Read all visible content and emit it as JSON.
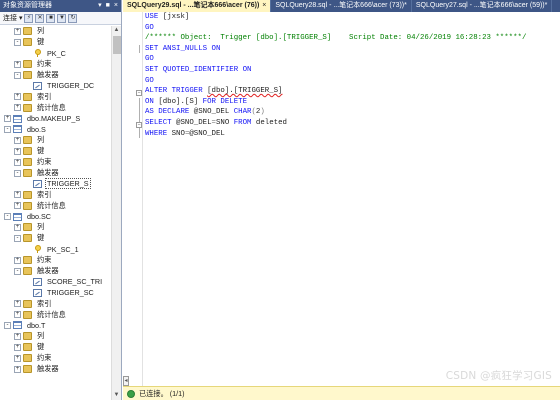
{
  "object_explorer": {
    "title": "对象资源管理器",
    "pin_icons": [
      "▾",
      "📌",
      "×"
    ],
    "toolbar": {
      "connect_label": "连接 ▾"
    },
    "tree": [
      {
        "indent": 1,
        "expander": "+",
        "icon": "folder",
        "label": "列"
      },
      {
        "indent": 1,
        "expander": "-",
        "icon": "folder",
        "label": "键"
      },
      {
        "indent": 2,
        "expander": "",
        "icon": "key",
        "label": "PK_C"
      },
      {
        "indent": 1,
        "expander": "+",
        "icon": "folder",
        "label": "约束"
      },
      {
        "indent": 1,
        "expander": "-",
        "icon": "folder",
        "label": "触发器"
      },
      {
        "indent": 2,
        "expander": "",
        "icon": "trig",
        "label": "TRIGGER_DC"
      },
      {
        "indent": 1,
        "expander": "+",
        "icon": "folder",
        "label": "索引"
      },
      {
        "indent": 1,
        "expander": "+",
        "icon": "folder",
        "label": "统计信息"
      },
      {
        "indent": 0,
        "expander": "+",
        "icon": "table",
        "label": "dbo.MAKEUP_S"
      },
      {
        "indent": 0,
        "expander": "-",
        "icon": "table",
        "label": "dbo.S"
      },
      {
        "indent": 1,
        "expander": "+",
        "icon": "folder",
        "label": "列"
      },
      {
        "indent": 1,
        "expander": "+",
        "icon": "folder",
        "label": "键"
      },
      {
        "indent": 1,
        "expander": "+",
        "icon": "folder",
        "label": "约束"
      },
      {
        "indent": 1,
        "expander": "-",
        "icon": "folder",
        "label": "触发器"
      },
      {
        "indent": 2,
        "expander": "",
        "icon": "trig",
        "label": "TRIGGER_S",
        "selected": true
      },
      {
        "indent": 1,
        "expander": "+",
        "icon": "folder",
        "label": "索引"
      },
      {
        "indent": 1,
        "expander": "+",
        "icon": "folder",
        "label": "统计信息"
      },
      {
        "indent": 0,
        "expander": "-",
        "icon": "table",
        "label": "dbo.SC"
      },
      {
        "indent": 1,
        "expander": "+",
        "icon": "folder",
        "label": "列"
      },
      {
        "indent": 1,
        "expander": "-",
        "icon": "folder",
        "label": "键"
      },
      {
        "indent": 2,
        "expander": "",
        "icon": "key",
        "label": "PK_SC_1"
      },
      {
        "indent": 1,
        "expander": "+",
        "icon": "folder",
        "label": "约束"
      },
      {
        "indent": 1,
        "expander": "-",
        "icon": "folder",
        "label": "触发器"
      },
      {
        "indent": 2,
        "expander": "",
        "icon": "trig",
        "label": "SCORE_SC_TRI"
      },
      {
        "indent": 2,
        "expander": "",
        "icon": "trig",
        "label": "TRIGGER_SC"
      },
      {
        "indent": 1,
        "expander": "+",
        "icon": "folder",
        "label": "索引"
      },
      {
        "indent": 1,
        "expander": "+",
        "icon": "folder",
        "label": "统计信息"
      },
      {
        "indent": 0,
        "expander": "-",
        "icon": "table",
        "label": "dbo.T"
      },
      {
        "indent": 1,
        "expander": "+",
        "icon": "folder",
        "label": "列"
      },
      {
        "indent": 1,
        "expander": "+",
        "icon": "folder",
        "label": "键"
      },
      {
        "indent": 1,
        "expander": "+",
        "icon": "folder",
        "label": "约束"
      },
      {
        "indent": 1,
        "expander": "+",
        "icon": "folder",
        "label": "触发器"
      }
    ]
  },
  "tabs": [
    {
      "label": "SQLQuery29.sql - ...笔记本666\\acer (76))",
      "active": true,
      "close": "×"
    },
    {
      "label": "SQLQuery28.sql - ...笔记本666\\acer (73))*",
      "active": false,
      "close": "×"
    },
    {
      "label": "SQLQuery27.sql - ...笔记本666\\acer (59))*",
      "active": false,
      "close": "×"
    }
  ],
  "code_lines": [
    [
      {
        "t": "USE ",
        "c": "kw"
      },
      {
        "t": "[jxsk]",
        "c": "sq"
      }
    ],
    [
      {
        "t": "GO",
        "c": "kw"
      }
    ],
    [
      {
        "t": "/****** Object:  Trigger [dbo].[TRIGGER_S]    Script Date: 04/26/2019 16:28:23 ******/",
        "c": "cm"
      }
    ],
    [
      {
        "t": "SET ANSI_NULLS ON",
        "c": "kw"
      }
    ],
    [
      {
        "t": "GO",
        "c": "kw"
      }
    ],
    [
      {
        "t": "SET QUOTED_IDENTIFIER ON",
        "c": "kw"
      }
    ],
    [
      {
        "t": "GO",
        "c": "kw"
      }
    ],
    [
      {
        "t": "ALTER TRIGGER ",
        "c": "kw"
      },
      {
        "t": "[dbo].[TRIGGER_S]",
        "c": "sq ul"
      }
    ],
    [
      {
        "t": "ON ",
        "c": "kw"
      },
      {
        "t": "[dbo].[S] ",
        "c": "sq"
      },
      {
        "t": "FOR DELETE",
        "c": "kw"
      }
    ],
    [
      {
        "t": "AS DECLARE ",
        "c": "kw"
      },
      {
        "t": "@SNO_DEL ",
        "c": "sq"
      },
      {
        "t": "CHAR",
        "c": "kw"
      },
      {
        "t": "(",
        "c": "gray"
      },
      {
        "t": "2",
        "c": "sq"
      },
      {
        "t": ")",
        "c": "gray"
      }
    ],
    [
      {
        "t": "SELECT ",
        "c": "kw"
      },
      {
        "t": "@SNO_DEL",
        "c": "sq"
      },
      {
        "t": "=",
        "c": "gray"
      },
      {
        "t": "SNO ",
        "c": "sq"
      },
      {
        "t": "FROM ",
        "c": "kw"
      },
      {
        "t": "deleted",
        "c": "sq"
      }
    ],
    [
      {
        "t": "WHERE ",
        "c": "kw"
      },
      {
        "t": "SNO",
        "c": "sq"
      },
      {
        "t": "=",
        "c": "gray"
      },
      {
        "t": "@SNO_DEL",
        "c": "sq"
      }
    ]
  ],
  "status": {
    "text": "已连接。 (1/1)"
  },
  "watermark": "CSDN @疯狂学习GIS"
}
